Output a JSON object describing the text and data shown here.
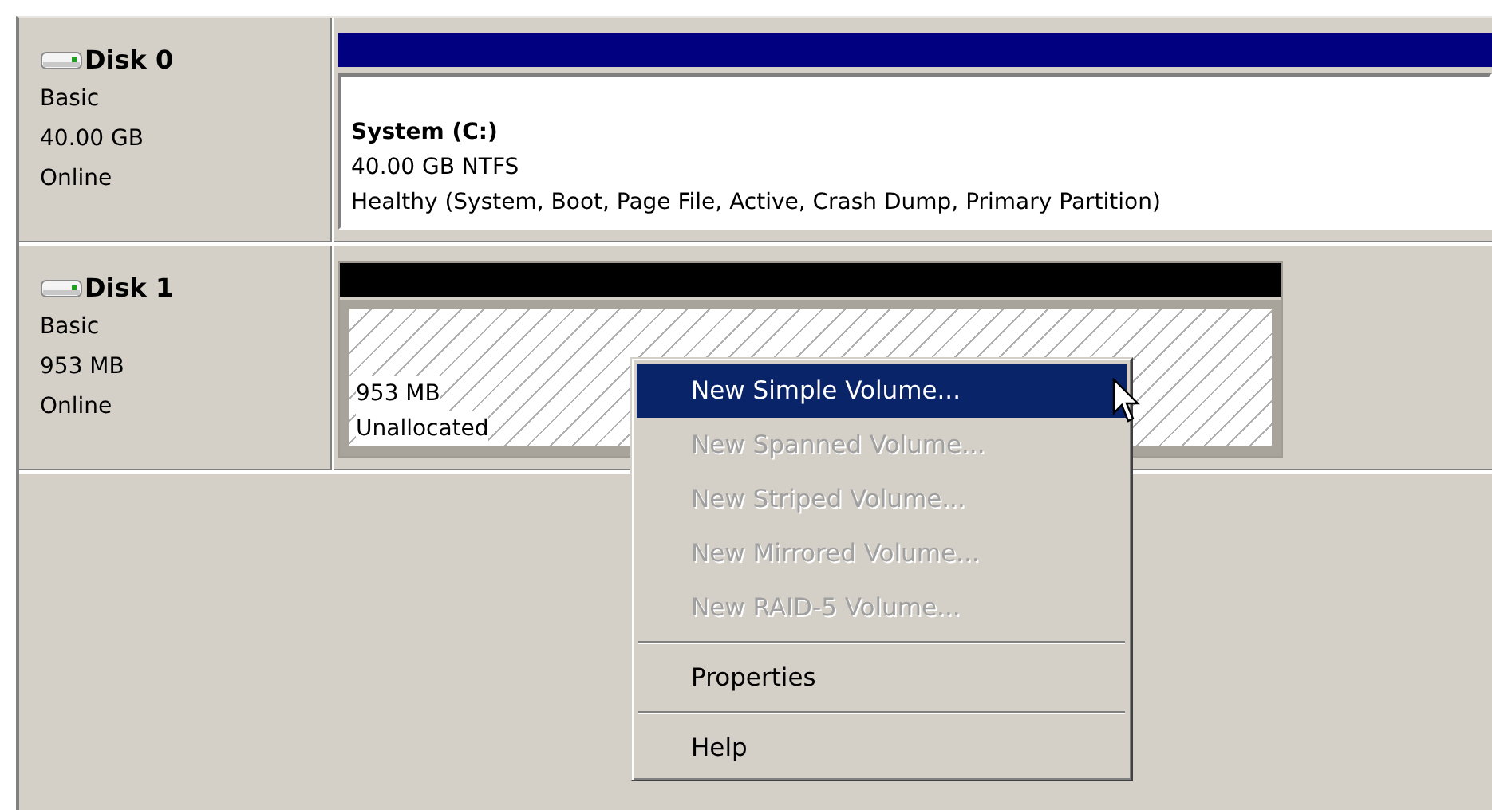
{
  "disks": [
    {
      "name": "Disk 0",
      "type": "Basic",
      "size": "40.00 GB",
      "status": "Online",
      "partitions": [
        {
          "kind": "primary",
          "title": "System  (C:)",
          "detail": "40.00 GB NTFS",
          "status": "Healthy (System, Boot, Page File, Active, Crash Dump, Primary Partition)"
        }
      ]
    },
    {
      "name": "Disk 1",
      "type": "Basic",
      "size": "953 MB",
      "status": "Online",
      "partitions": [
        {
          "kind": "unallocated",
          "detail": "953 MB",
          "status": "Unallocated"
        }
      ]
    }
  ],
  "context_menu": {
    "items": [
      {
        "kind": "item",
        "label": "New Simple Volume...",
        "selected": true,
        "disabled": false
      },
      {
        "kind": "item",
        "label": "New Spanned Volume...",
        "selected": false,
        "disabled": true
      },
      {
        "kind": "item",
        "label": "New Striped Volume...",
        "selected": false,
        "disabled": true
      },
      {
        "kind": "item",
        "label": "New Mirrored Volume...",
        "selected": false,
        "disabled": true
      },
      {
        "kind": "item",
        "label": "New RAID-5 Volume...",
        "selected": false,
        "disabled": true
      },
      {
        "kind": "separator"
      },
      {
        "kind": "item",
        "label": "Properties",
        "selected": false,
        "disabled": false
      },
      {
        "kind": "separator"
      },
      {
        "kind": "item",
        "label": "Help",
        "selected": false,
        "disabled": false
      }
    ]
  }
}
